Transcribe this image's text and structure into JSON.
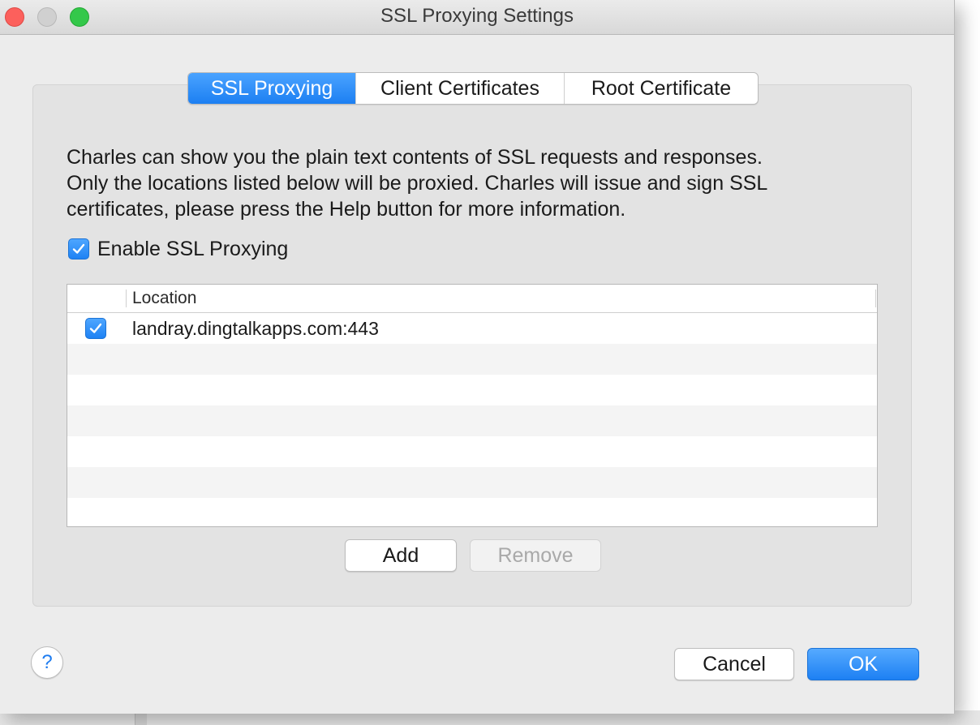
{
  "window": {
    "title": "SSL Proxying Settings"
  },
  "tabs": [
    {
      "label": "SSL Proxying",
      "active": true
    },
    {
      "label": "Client Certificates",
      "active": false
    },
    {
      "label": "Root Certificate",
      "active": false
    }
  ],
  "ssl_proxying": {
    "description_lines": [
      "Charles can show you the plain text contents of SSL requests and responses.",
      "Only the locations listed below will be proxied. Charles will issue and sign SSL",
      "certificates, please press the Help button for more information."
    ],
    "enable_label": "Enable SSL Proxying",
    "enable_checked": true,
    "table": {
      "columns": [
        "",
        "Location"
      ],
      "rows": [
        {
          "enabled": true,
          "location": "landray.dingtalkapps.com:443"
        }
      ]
    },
    "add_label": "Add",
    "remove_label": "Remove"
  },
  "footer": {
    "help_label": "?",
    "cancel_label": "Cancel",
    "ok_label": "OK"
  },
  "colors": {
    "accent": "#1e82f4",
    "window_bg": "#ececec"
  }
}
